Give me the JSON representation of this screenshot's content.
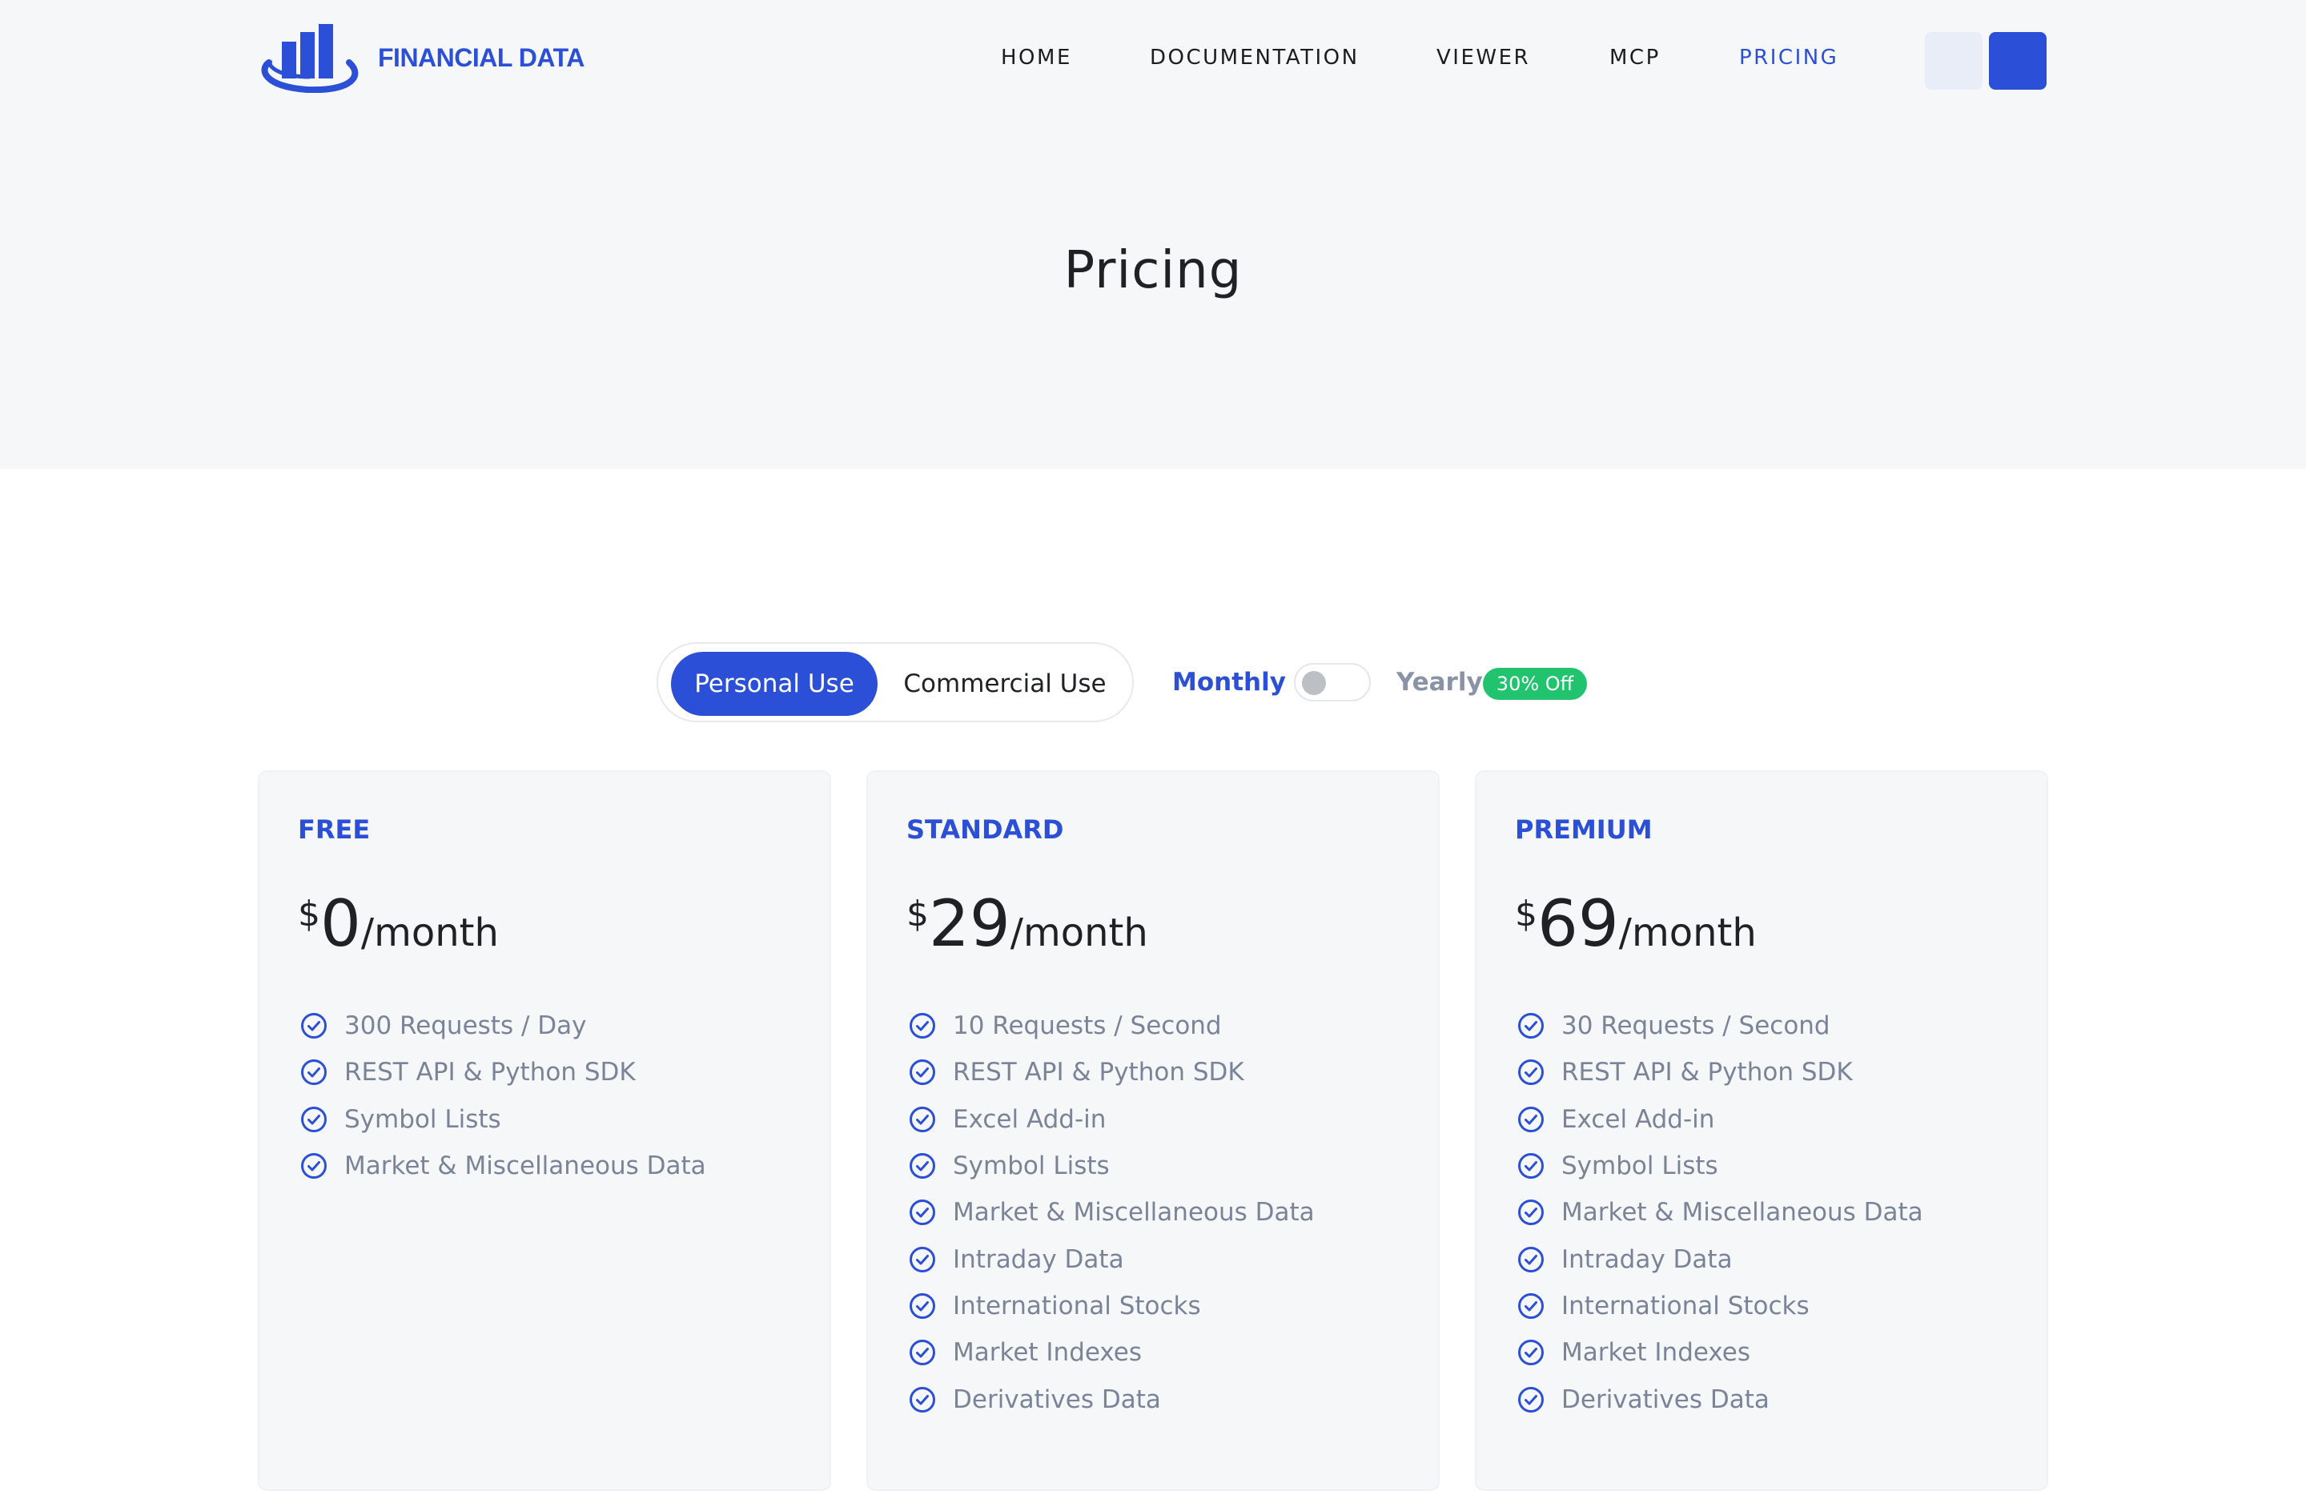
{
  "brand": {
    "name": "FINANCIAL DATA",
    "logo_icon": "bar-chart-ring-logo",
    "color": "#2b4fd6"
  },
  "nav": {
    "items": [
      {
        "label": "HOME",
        "active": false
      },
      {
        "label": "DOCUMENTATION",
        "active": false
      },
      {
        "label": "VIEWER",
        "active": false
      },
      {
        "label": "MCP",
        "active": false
      },
      {
        "label": "PRICING",
        "active": true
      }
    ]
  },
  "header_buttons": {
    "secondary_color": "#e9edf7",
    "primary_color": "#2b4fd6"
  },
  "page": {
    "title": "Pricing"
  },
  "use_toggle": {
    "options": [
      "Personal Use",
      "Commercial Use"
    ],
    "selected": "Personal Use"
  },
  "billing": {
    "monthly_label": "Monthly",
    "yearly_label": "Yearly",
    "selected": "Monthly",
    "discount_badge": "30% Off",
    "discount_color": "#22c36e"
  },
  "plans": [
    {
      "name": "FREE",
      "currency": "$",
      "amount": "0",
      "period": "/month",
      "features": [
        "300 Requests / Day",
        "REST API & Python SDK",
        "Symbol Lists",
        "Market & Miscellaneous Data"
      ]
    },
    {
      "name": "STANDARD",
      "currency": "$",
      "amount": "29",
      "period": "/month",
      "features": [
        "10 Requests / Second",
        "REST API & Python SDK",
        "Excel Add-in",
        "Symbol Lists",
        "Market & Miscellaneous Data",
        "Intraday Data",
        "International Stocks",
        "Market Indexes",
        "Derivatives Data"
      ]
    },
    {
      "name": "PREMIUM",
      "currency": "$",
      "amount": "69",
      "period": "/month",
      "features": [
        "30 Requests / Second",
        "REST API & Python SDK",
        "Excel Add-in",
        "Symbol Lists",
        "Market & Miscellaneous Data",
        "Intraday Data",
        "International Stocks",
        "Market Indexes",
        "Derivatives Data"
      ]
    }
  ],
  "feature_icon": "check-circle-icon"
}
